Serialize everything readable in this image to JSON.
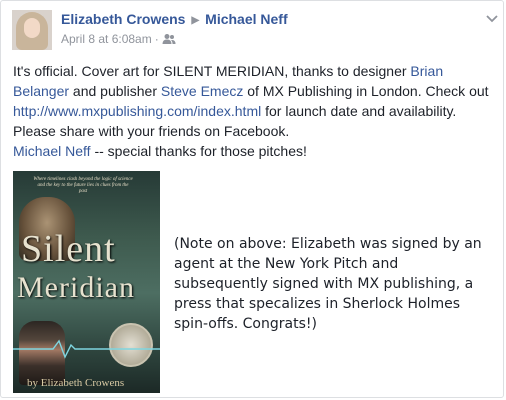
{
  "post": {
    "author": "Elizabeth Crowens",
    "target": "Michael Neff",
    "timestamp": "April 8 at 6:08am",
    "text": {
      "p1_a": "It's official. Cover art for SILENT MERIDIAN, thanks to designer ",
      "p1_link_designer": "Brian Belanger",
      "p1_b": " and publisher ",
      "p1_link_publisher": "Steve Emecz",
      "p1_c": " of MX Publishing in London. Check out ",
      "p1_link_url": "http://www.mxpublishing.com/index.html",
      "p1_d": " for launch date and availability. Please share with your friends on Facebook.",
      "p2_link": "Michael Neff",
      "p2_text": " -- special thanks for those pitches!"
    },
    "cover": {
      "blurb": "Where timelines clash beyond the logic of science and the key to the future lies in clues from the past",
      "title_line1": "Silent",
      "title_line2": "Meridian",
      "author_line": "by Elizabeth Crowens"
    }
  },
  "annotation": {
    "note": "(Note on above: Elizabeth was signed by an agent at the New York Pitch and subsequently signed with MX publishing, a press that specalizes in Sherlock Holmes spin-offs. Congrats!)"
  },
  "icons": {
    "arrow": "right-triangle",
    "audience": "friends-icon",
    "menu": "chevron-down-icon"
  },
  "colors": {
    "link": "#365899",
    "meta": "#90949c",
    "text": "#1d2129"
  }
}
